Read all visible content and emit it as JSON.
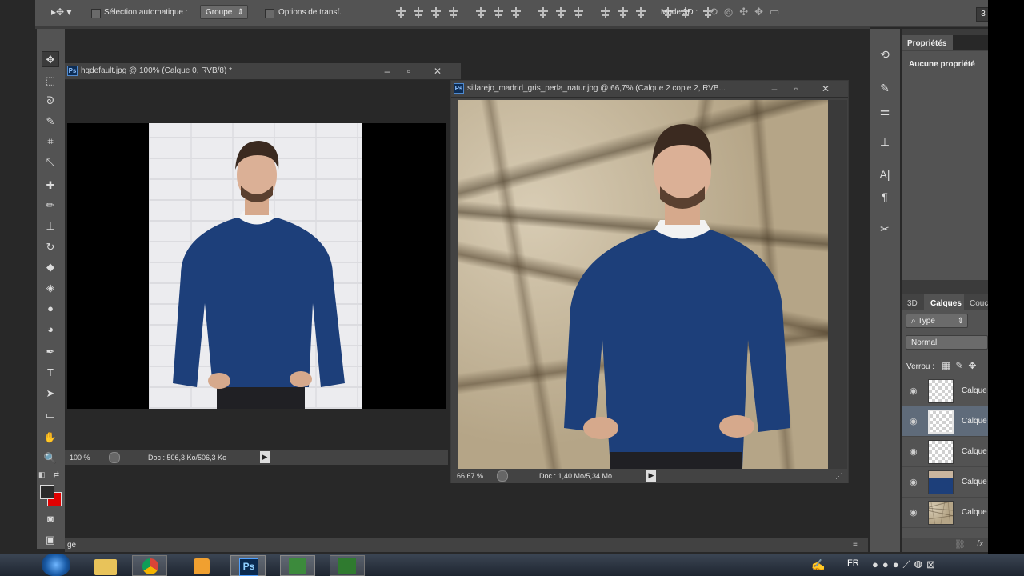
{
  "options_bar": {
    "auto_select_label": "Sélection automatique :",
    "auto_select_value": "Groupe",
    "transform_label": "Options de transf.",
    "mode3d_label": "Mode 3D :",
    "right_badge": "3"
  },
  "documents": [
    {
      "title": "hqdefault.jpg @ 100% (Calque 0, RVB/8) *",
      "zoom": "100 %",
      "doc_info": "Doc : 506,3 Ko/506,3 Ko"
    },
    {
      "title": "sillarejo_madrid_gris_perla_natur.jpg @ 66,7% (Calque 2 copie 2, RVB...",
      "zoom": "66,67 %",
      "doc_info": "Doc : 1,40 Mo/5,34 Mo"
    }
  ],
  "properties_panel": {
    "tab": "Propriétés",
    "empty_text": "Aucune propriété"
  },
  "layers_panel": {
    "tabs": [
      "3D",
      "Calques",
      "Couc"
    ],
    "active_tab": "Calques",
    "filter_label": "Type",
    "blend_mode": "Normal",
    "lock_label": "Verrou :",
    "layers": [
      {
        "name": "Calque",
        "thumb": "transparent"
      },
      {
        "name": "Calque",
        "thumb": "transparent-selected"
      },
      {
        "name": "Calque",
        "thumb": "transparent"
      },
      {
        "name": "Calque",
        "thumb": "man-in-sweater"
      },
      {
        "name": "Calque",
        "thumb": "stone-wall"
      }
    ]
  },
  "bottom_strip_text": "ge",
  "taskbar": {
    "language": "FR",
    "apps": [
      "windows-start-icon",
      "folder-icon",
      "chrome-icon",
      "media-player-icon",
      "photoshop-icon",
      "camtasia-icon",
      "camtasia-recorder-icon"
    ]
  },
  "colors": {
    "panel_bg": "#535353",
    "workspace_bg": "#282828",
    "fg_swatch": "#2b2b2b",
    "bg_swatch": "#e00000",
    "sweater": "#1d3f7a"
  }
}
